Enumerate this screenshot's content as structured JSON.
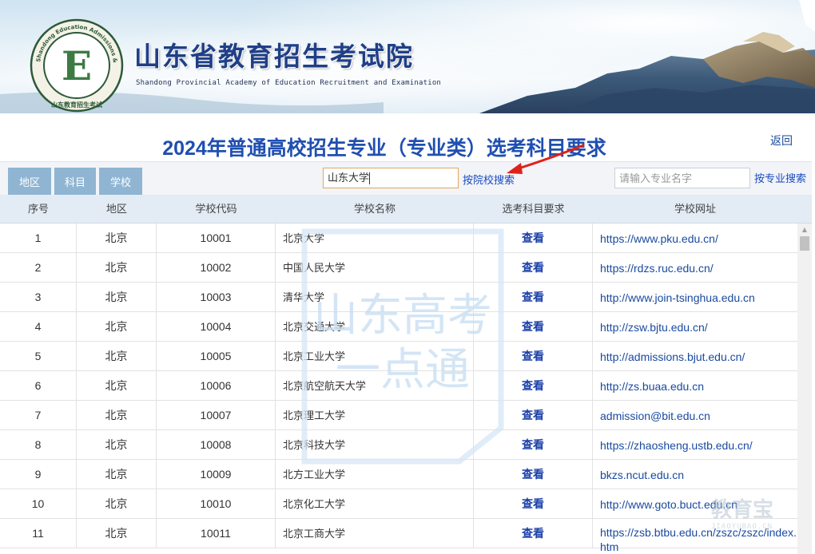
{
  "banner": {
    "title": "山东省教育招生考试院",
    "subtitle": "Shandong Provincial Academy of Education Recruitment and Examination",
    "seal_ring_text": "Shandong Education Admissions & Examinations",
    "seal_bottom_text": "山东教育招生考试",
    "seal_letter": "E"
  },
  "page": {
    "title": "2024年普通高校招生专业（专业类）选考科目要求",
    "back_label": "返回"
  },
  "filters": {
    "tabs": [
      "地区",
      "科目",
      "学校"
    ],
    "school_input_value": "山东大学",
    "school_search_label": "按院校搜索",
    "major_placeholder": "请输入专业名字",
    "major_search_label": "按专业搜索"
  },
  "table": {
    "headers": [
      "序号",
      "地区",
      "学校代码",
      "学校名称",
      "选考科目要求",
      "学校网址"
    ],
    "view_label": "查看",
    "rows": [
      {
        "no": "1",
        "region": "北京",
        "code": "10001",
        "name": "北京大学",
        "url": "https://www.pku.edu.cn/"
      },
      {
        "no": "2",
        "region": "北京",
        "code": "10002",
        "name": "中国人民大学",
        "url": "https://rdzs.ruc.edu.cn/"
      },
      {
        "no": "3",
        "region": "北京",
        "code": "10003",
        "name": "清华大学",
        "url": "http://www.join-tsinghua.edu.cn"
      },
      {
        "no": "4",
        "region": "北京",
        "code": "10004",
        "name": "北京交通大学",
        "url": "http://zsw.bjtu.edu.cn/"
      },
      {
        "no": "5",
        "region": "北京",
        "code": "10005",
        "name": "北京工业大学",
        "url": "http://admissions.bjut.edu.cn/"
      },
      {
        "no": "6",
        "region": "北京",
        "code": "10006",
        "name": "北京航空航天大学",
        "url": "http://zs.buaa.edu.cn"
      },
      {
        "no": "7",
        "region": "北京",
        "code": "10007",
        "name": "北京理工大学",
        "url": "admission@bit.edu.cn"
      },
      {
        "no": "8",
        "region": "北京",
        "code": "10008",
        "name": "北京科技大学",
        "url": "https://zhaosheng.ustb.edu.cn/"
      },
      {
        "no": "9",
        "region": "北京",
        "code": "10009",
        "name": "北方工业大学",
        "url": "bkzs.ncut.edu.cn"
      },
      {
        "no": "10",
        "region": "北京",
        "code": "10010",
        "name": "北京化工大学",
        "url": "http://www.goto.buct.edu.cn"
      },
      {
        "no": "11",
        "region": "北京",
        "code": "10011",
        "name": "北京工商大学",
        "url": "https://zsb.btbu.edu.cn/zszc/zszc/index.htm"
      }
    ]
  },
  "watermarks": {
    "center_line1": "山东高考",
    "center_line2": "一点通",
    "corner_big": "教育宝",
    "corner_small": "JIAOYUBAO.CN"
  },
  "colors": {
    "title_blue": "#1f4fb0",
    "tab_bg": "#8fb5d3",
    "link_blue": "#1a4ac0",
    "arrow_red": "#e0211a"
  }
}
